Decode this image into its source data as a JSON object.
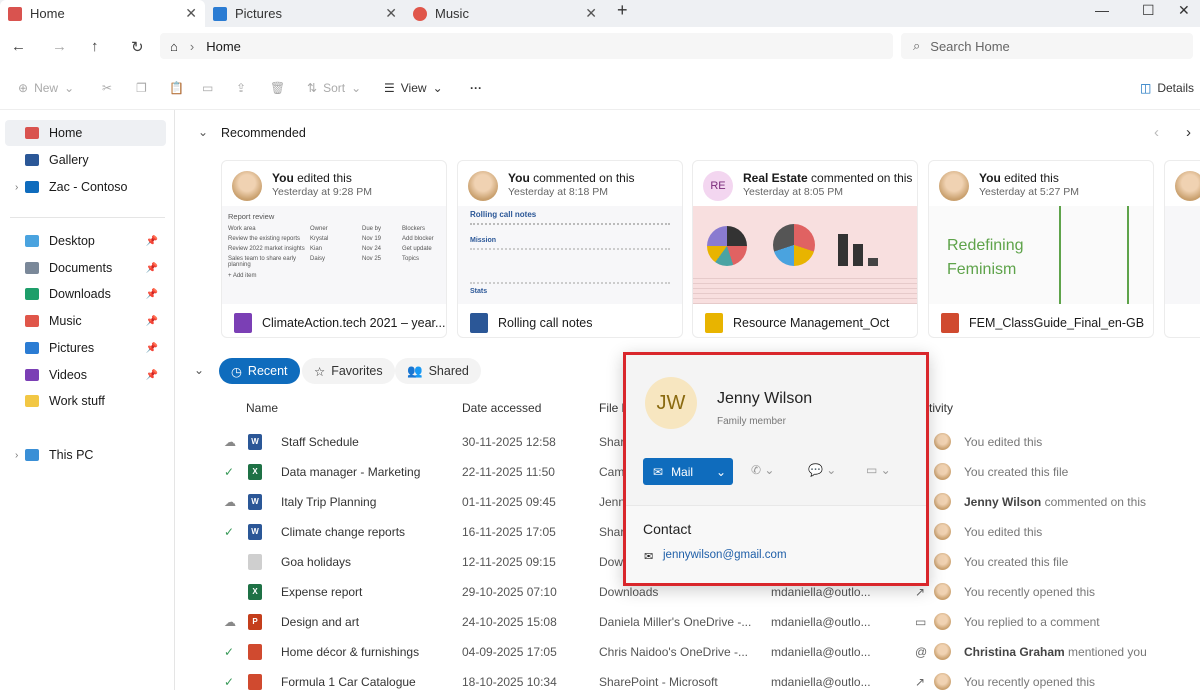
{
  "tabs": [
    {
      "label": "Home",
      "color": "#d9534f"
    },
    {
      "label": "Pictures",
      "color": "#2b7cd3"
    },
    {
      "label": "Music",
      "color": "#e0564a"
    }
  ],
  "address": {
    "breadcrumb": "Home",
    "search_placeholder": "Search Home"
  },
  "toolbar": {
    "new": "New",
    "sort": "Sort",
    "view": "View",
    "more": "···",
    "details": "Details"
  },
  "sidebar": {
    "items": [
      {
        "label": "Home",
        "color": "#d9534f",
        "selected": true
      },
      {
        "label": "Gallery",
        "color": "#2b5797"
      },
      {
        "label": "Zac - Contoso",
        "color": "#0f6cbd"
      },
      {
        "label": "Desktop",
        "color": "#4aa3df"
      },
      {
        "label": "Documents",
        "color": "#7a8899"
      },
      {
        "label": "Downloads",
        "color": "#1e9e6a"
      },
      {
        "label": "Music",
        "color": "#e0564a"
      },
      {
        "label": "Pictures",
        "color": "#2b7cd3"
      },
      {
        "label": "Videos",
        "color": "#7b3fb5"
      },
      {
        "label": "Work stuff",
        "color": "#f2c744"
      },
      {
        "label": "This PC",
        "color": "#3a8fd6"
      }
    ]
  },
  "recommended": {
    "title": "Recommended",
    "cards": [
      {
        "who": "You",
        "action": "edited this",
        "when": "Yesterday at 9:28 PM",
        "file": "ClimateAction.tech 2021 – year...",
        "icon_color": "#7b3fb5"
      },
      {
        "who": "You",
        "action": "commented on this",
        "when": "Yesterday at 8:18 PM",
        "file": "Rolling call notes",
        "icon_color": "#2b5797"
      },
      {
        "who": "Real Estate",
        "action": "commented on this",
        "when": "Yesterday at 8:05 PM",
        "file": "Resource Management_Oct",
        "icon_color": "#e8b400",
        "initials": "RE"
      },
      {
        "who": "You",
        "action": "edited this",
        "when": "Yesterday at 5:27 PM",
        "file": "FEM_ClassGuide_Final_en-GB",
        "icon_color": "#d04a2f"
      }
    ],
    "thumb1": {
      "title": "Report review",
      "headers": [
        "Work area",
        "Owner",
        "Due by",
        "Blockers"
      ],
      "rows": [
        [
          "Review the existing reports",
          "Krystal",
          "Nov 19",
          "Add blocker"
        ],
        [
          "Review 2022 market insights",
          "Kian",
          "Nov 24",
          "Get update"
        ],
        [
          "Sales team to share early planning",
          "Daisy",
          "Nov 25",
          "Topics"
        ]
      ],
      "add": "+ Add item"
    },
    "thumb2": {
      "title": "Rolling call notes",
      "h1": "Mission",
      "h2": "Stats"
    },
    "thumb4": {
      "title1": "Redefining",
      "title2": "Feminism"
    }
  },
  "filters": {
    "recent": "Recent",
    "favorites": "Favorites",
    "shared": "Shared"
  },
  "columns": {
    "name": "Name",
    "date": "Date accessed",
    "location": "File location",
    "activity": "Activity"
  },
  "files": [
    {
      "sync": "cloud",
      "type": "W",
      "color": "#2b5797",
      "name": "Staff Schedule",
      "date": "30-11-2025 12:58",
      "loc": "SharePoint - Microsoft",
      "owner": "",
      "act_icon": "",
      "actor": "",
      "activity": "You edited this"
    },
    {
      "sync": "check",
      "type": "X",
      "color": "#1e7145",
      "name": "Data manager - Marketing",
      "date": "22-11-2025 11:50",
      "loc": "Cameron's OneDrive",
      "owner": "",
      "act_icon": "",
      "actor": "",
      "activity": "You created this file"
    },
    {
      "sync": "cloud",
      "type": "W",
      "color": "#2b5797",
      "name": "Italy Trip Planning",
      "date": "01-11-2025 09:45",
      "loc": "Jenny's OneDrive",
      "owner": "",
      "act_icon": "",
      "actor": "Jenny Wilson",
      "activity": "commented on this"
    },
    {
      "sync": "check",
      "type": "W",
      "color": "#2b5797",
      "name": "Climate change reports",
      "date": "16-11-2025 17:05",
      "loc": "SharePoint - Microsoft",
      "owner": "",
      "act_icon": "",
      "actor": "",
      "activity": "You edited this"
    },
    {
      "sync": "",
      "type": "",
      "color": "#cfcfcf",
      "name": "Goa holidays",
      "date": "12-11-2025 09:15",
      "loc": "Downloads",
      "owner": "",
      "act_icon": "",
      "actor": "",
      "activity": "You created this file"
    },
    {
      "sync": "",
      "type": "X",
      "color": "#1e7145",
      "name": "Expense report",
      "date": "29-10-2025 07:10",
      "loc": "Downloads",
      "owner": "mdaniella@outlo...",
      "act_icon": "↗",
      "actor": "",
      "activity": "You recently opened this"
    },
    {
      "sync": "cloud",
      "type": "P",
      "color": "#c43e1c",
      "name": "Design and art",
      "date": "24-10-2025 15:08",
      "loc": "Daniela Miller's OneDrive -...",
      "owner": "mdaniella@outlo...",
      "act_icon": "▭",
      "actor": "",
      "activity": "You replied to a comment"
    },
    {
      "sync": "check",
      "type": "",
      "color": "#d04a2f",
      "name": "Home décor & furnishings",
      "date": "04-09-2025 17:05",
      "loc": "Chris Naidoo's OneDrive -...",
      "owner": "mdaniella@outlo...",
      "act_icon": "@",
      "actor": "Christina Graham",
      "activity": "mentioned you"
    },
    {
      "sync": "check",
      "type": "",
      "color": "#d04a2f",
      "name": "Formula 1 Car Catalogue",
      "date": "18-10-2025 10:34",
      "loc": "SharePoint - Microsoft",
      "owner": "mdaniella@outlo...",
      "act_icon": "↗",
      "actor": "",
      "activity": "You recently opened this"
    }
  ],
  "contact_card": {
    "initials": "JW",
    "name": "Jenny Wilson",
    "role": "Family member",
    "mail": "Mail",
    "contact_heading": "Contact",
    "email": "jennywilson@gmail.com",
    "accent": "#0f6cbd",
    "highlight": "#d9262b"
  }
}
